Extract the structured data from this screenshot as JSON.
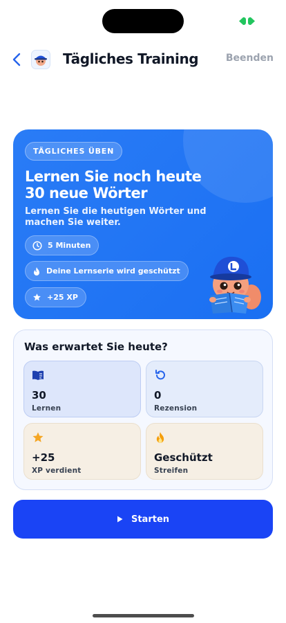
{
  "header": {
    "title": "Tägliches Training",
    "end_label": "Beenden"
  },
  "hero": {
    "badge": "TÄGLICHES ÜBEN",
    "title_line1": "Lernen Sie noch heute",
    "title_line2": "30 neue Wörter",
    "subtitle": "Lernen Sie die heutigen Wörter und machen Sie weiter.",
    "chips": [
      {
        "icon": "clock-icon",
        "label": "5 Minuten"
      },
      {
        "icon": "flame-icon",
        "label": "Deine Lernserie wird geschützt"
      },
      {
        "icon": "star-icon",
        "label": "+25 XP"
      }
    ]
  },
  "expect": {
    "title": "Was erwartet Sie heute?",
    "tiles": [
      {
        "icon": "book-icon",
        "value": "30",
        "label": "Lernen"
      },
      {
        "icon": "refresh-icon",
        "value": "0",
        "label": "Rezension"
      },
      {
        "icon": "star-icon",
        "value": "+25",
        "label": "XP verdient"
      },
      {
        "icon": "flame-icon",
        "value": "Geschützt",
        "label": "Streifen"
      }
    ]
  },
  "start_button": {
    "label": "Starten"
  },
  "colors": {
    "accent": "#1a44f5",
    "hero_blue": "#2a7cf6",
    "muted_text": "#9ca3af",
    "star": "#f5a623",
    "flame": "#f59e0b"
  }
}
